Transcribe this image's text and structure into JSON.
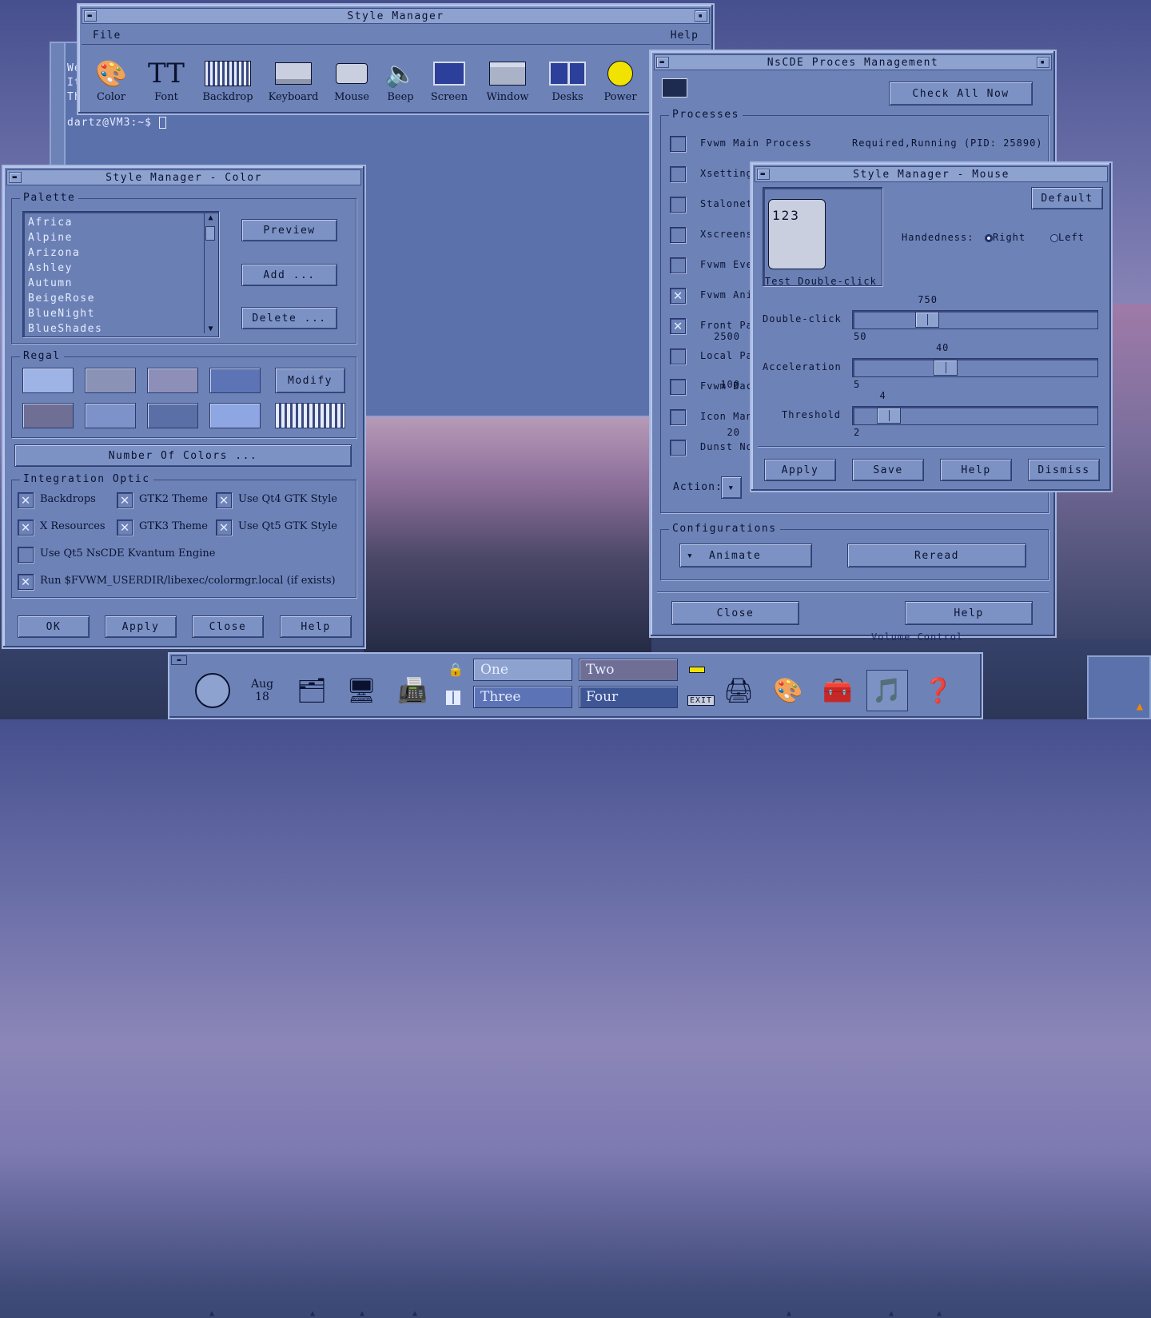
{
  "terminal": {
    "lines": [
      "We",
      "It",
      "Th"
    ],
    "prompt": "dartz@VM3:~$"
  },
  "style_manager": {
    "title": "Style Manager",
    "menu": {
      "file": "File",
      "help": "Help"
    },
    "tools": [
      {
        "label": "Color",
        "icon": "palette-icon"
      },
      {
        "label": "Font",
        "icon": "font-icon"
      },
      {
        "label": "Backdrop",
        "icon": "backdrop-icon"
      },
      {
        "label": "Keyboard",
        "icon": "keyboard-icon"
      },
      {
        "label": "Mouse",
        "icon": "mouse-icon"
      },
      {
        "label": "Beep",
        "icon": "speaker-icon"
      },
      {
        "label": "Screen",
        "icon": "screen-icon"
      },
      {
        "label": "Window",
        "icon": "window-icon"
      },
      {
        "label": "Desks",
        "icon": "desks-icon"
      },
      {
        "label": "Power",
        "icon": "power-icon"
      }
    ]
  },
  "color": {
    "title": "Style Manager - Color",
    "palette_label": "Palette",
    "palettes": [
      "Africa",
      "Alpine",
      "Arizona",
      "Ashley",
      "Autumn",
      "BeigeRose",
      "BlueNight",
      "BlueShades"
    ],
    "preview": "Preview",
    "add": "Add ...",
    "delete": "Delete ...",
    "regal_label": "Regal",
    "swatches": [
      "#9fb4e6",
      "#8a93b6",
      "#8d8fb8",
      "#5c74b5",
      "#6f6f96",
      "#7c92c8",
      "#5a6fa6",
      "#8ea6e2"
    ],
    "modify": "Modify",
    "num_colors": "Number Of Colors ...",
    "integration_label": "Integration Optic",
    "options": [
      {
        "label": "Backdrops",
        "checked": true
      },
      {
        "label": "GTK2 Theme",
        "checked": true
      },
      {
        "label": "Use Qt4 GTK Style",
        "checked": true
      },
      {
        "label": "X Resources",
        "checked": true
      },
      {
        "label": "GTK3 Theme",
        "checked": true
      },
      {
        "label": "Use Qt5 GTK Style",
        "checked": true
      },
      {
        "label": "Use Qt5 NsCDE Kvantum Engine",
        "checked": false
      },
      {
        "label": "Run $FVWM_USERDIR/libexec/colormgr.local (if exists)",
        "checked": true
      }
    ],
    "buttons": {
      "ok": "OK",
      "apply": "Apply",
      "close": "Close",
      "help": "Help"
    }
  },
  "proc": {
    "title": "NsCDE Proces Management",
    "check_all": "Check All Now",
    "processes_label": "Processes",
    "items": [
      {
        "label": "Fvwm Main Process",
        "checked": false
      },
      {
        "label": "Xsetting",
        "checked": false
      },
      {
        "label": "Stalonet",
        "checked": false
      },
      {
        "label": "Xscreens",
        "checked": false
      },
      {
        "label": "Fvwm Eve",
        "checked": false
      },
      {
        "label": "Fvwm Ani",
        "checked": true
      },
      {
        "label": "Front Pa",
        "checked": true
      },
      {
        "label": "Local Pa",
        "checked": false
      },
      {
        "label": "Fvwm Bac",
        "checked": false
      },
      {
        "label": "Icon Man",
        "checked": false
      },
      {
        "label": "Dunst No",
        "checked": false
      }
    ],
    "status": "Required,Running (PID: 25890)",
    "action_label": "Action:",
    "config_label": "Configurations",
    "config_select": "Animate",
    "reread": "Reread",
    "close": "Close",
    "help": "Help"
  },
  "mouse": {
    "title": "Style Manager - Mouse",
    "test_label": "Test Double-click",
    "test_digits": "123",
    "default": "Default",
    "handedness": "Handedness:",
    "right": "Right",
    "left": "Left",
    "handedness_value": "Right",
    "sliders": [
      {
        "label": "Double-click",
        "min": "50",
        "max": "2500",
        "value": "750",
        "v": 750,
        "lo": 50,
        "hi": 2500
      },
      {
        "label": "Acceleration",
        "min": "5",
        "max": "100",
        "value": "40",
        "v": 40,
        "lo": 5,
        "hi": 100
      },
      {
        "label": "Threshold",
        "min": "2",
        "max": "20",
        "value": "4",
        "v": 4,
        "lo": 2,
        "hi": 20
      }
    ],
    "buttons": {
      "apply": "Apply",
      "save": "Save",
      "help": "Help",
      "dismiss": "Dismiss"
    }
  },
  "panel": {
    "date_month": "Aug",
    "date_day": "18",
    "workspaces": [
      "One",
      "Two",
      "Three",
      "Four"
    ],
    "exit": "EXIT",
    "volume": "Volume Control"
  }
}
